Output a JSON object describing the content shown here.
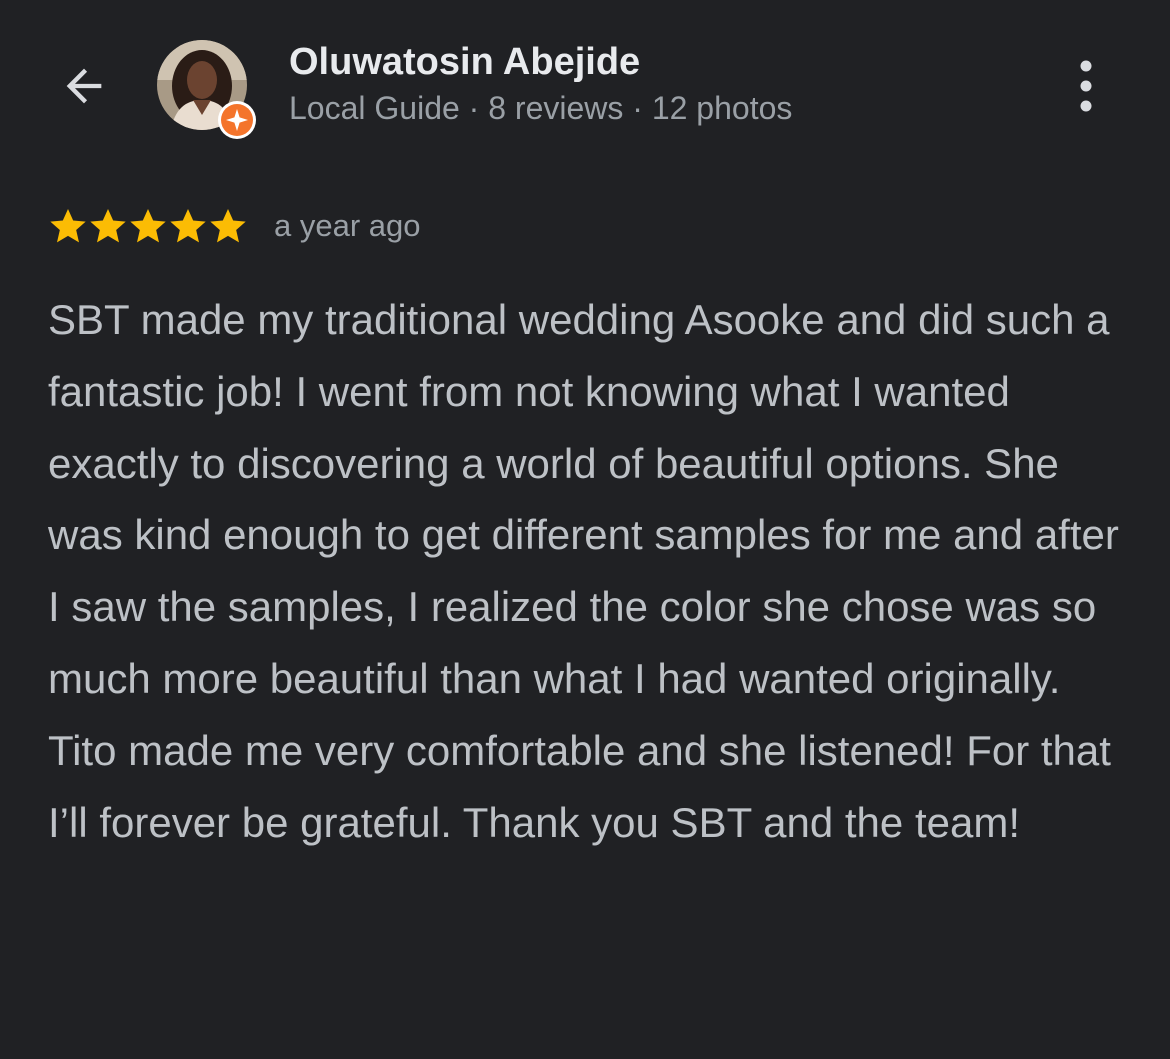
{
  "header": {
    "back_icon": "arrow-back-icon",
    "more_icon": "more-vert-icon"
  },
  "reviewer": {
    "name": "Oluwatosin Abejide",
    "meta": "Local Guide · 8 reviews · 12 photos",
    "badge_icon": "local-guide-badge-icon",
    "badge_color": "#f4742b"
  },
  "review": {
    "rating": 5,
    "rating_max": 5,
    "star_color": "#fbbc04",
    "date": "a year ago",
    "text": "SBT made my traditional wedding Asooke and did such a fantastic job! I went from not knowing what I wanted exactly to discovering a world of beautiful options. She was kind enough to get different samples for me and after I saw the samples, I realized the color she chose was so much more beautiful than what I had wanted originally. Tito made me very comfortable and she listened! For that I’ll forever be grateful. Thank you SBT and the team!"
  }
}
